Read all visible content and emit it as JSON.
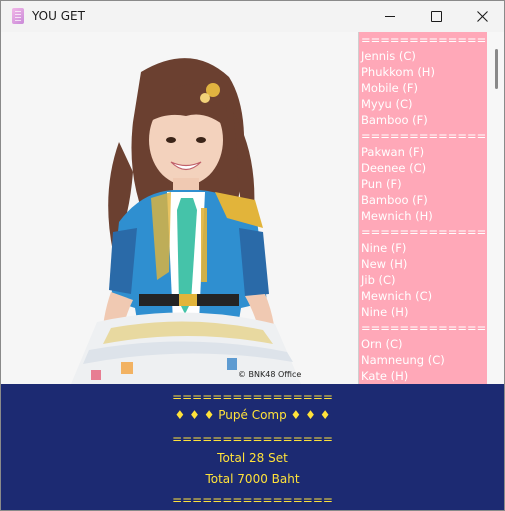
{
  "window": {
    "title": "YOU GET",
    "controls": {
      "minimize": "minimize",
      "maximize": "maximize",
      "close": "close"
    }
  },
  "photo": {
    "copyright": "© BNK48 Office"
  },
  "list": {
    "lines": [
      "================",
      "Jennis (C)",
      "Phukkom (H)",
      "Mobile (F)",
      "Myyu (C)",
      "Bamboo (F)",
      "================",
      "Pakwan (F)",
      "Deenee (C)",
      "Pun (F)",
      "Bamboo (F)",
      "Mewnich (H)",
      "================",
      "Nine (F)",
      "New (H)",
      "Jib (C)",
      "Mewnich (C)",
      "Nine (H)",
      "================",
      "Orn (C)",
      "Namneung (C)",
      "Kate (H)"
    ]
  },
  "footer": {
    "separator_top": "================",
    "heading": "♦ ♦ ♦ Pupé Comp ♦ ♦ ♦",
    "separator_mid": "================",
    "total_sets": "Total 28 Set",
    "total_price": "Total 7000 Baht",
    "separator_bottom": "================"
  },
  "colors": {
    "list_bg": "#ffa8b8",
    "footer_bg": "#1c2a72",
    "footer_text": "#ffe23a"
  }
}
